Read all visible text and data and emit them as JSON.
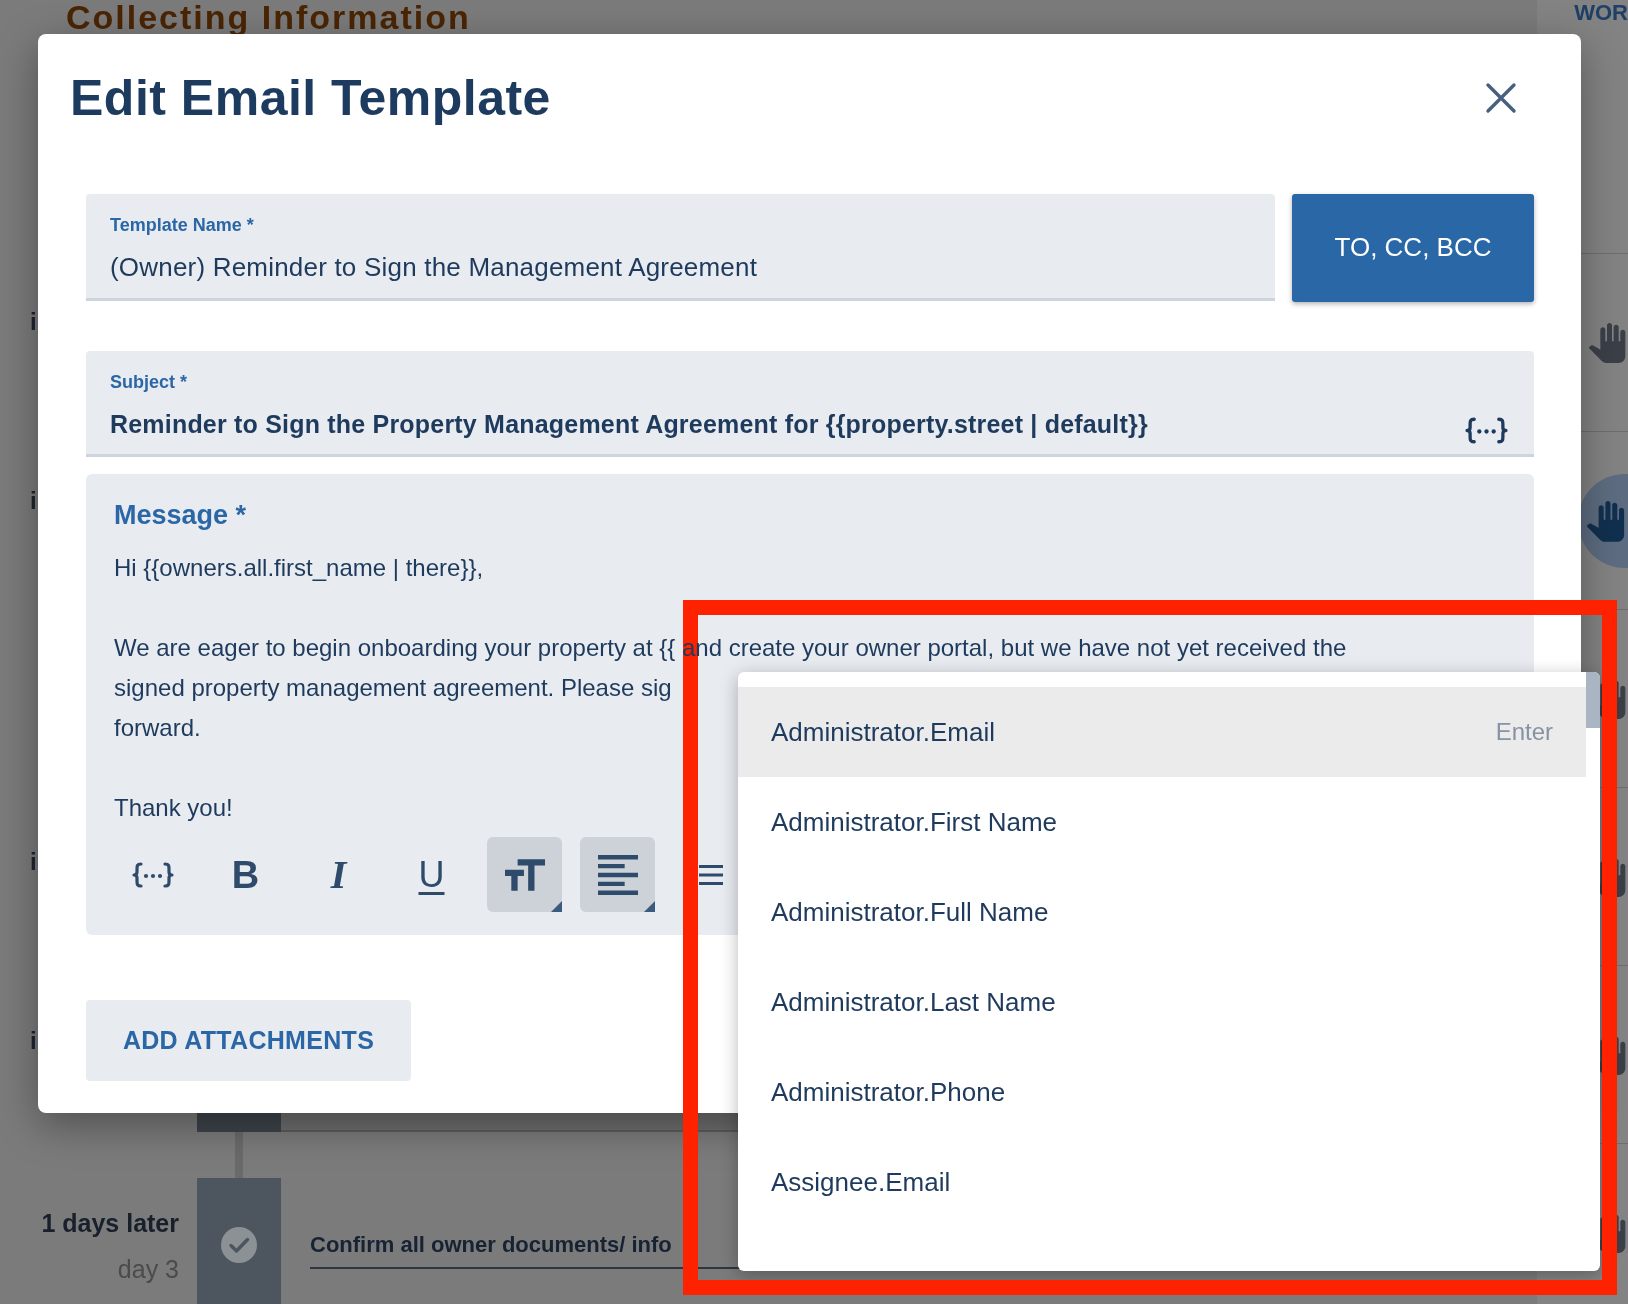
{
  "background_page": {
    "heading": "Collecting Information",
    "top_right_label": "WOR",
    "row_labels": [
      "i",
      "i",
      "i",
      "i"
    ],
    "step": {
      "timing": "1 days later",
      "day": "day 3",
      "title": "Confirm all owner documents/ info",
      "completed": true
    },
    "rail_buttons": [
      {
        "selected": false
      },
      {
        "selected": true
      },
      {
        "selected": false
      },
      {
        "selected": false
      },
      {
        "selected": false
      },
      {
        "selected": false
      }
    ]
  },
  "dialog": {
    "title": "Edit Email Template",
    "template_name": {
      "label": "Template Name *",
      "value": "(Owner) Reminder to Sign the Management Agreement"
    },
    "recipients_button": "TO, CC, BCC",
    "subject": {
      "label": "Subject *",
      "value": "Reminder to Sign the Property Management Agreement for {{property.street | default}}"
    },
    "message": {
      "label": "Message *",
      "paragraphs": [
        [
          "Hi {{owners.all.first_name | there}},"
        ],
        [
          "We are eager to begin onboarding your property at {{ and create your owner portal, but we have not yet received the",
          "signed property management agreement. Please sig",
          "forward."
        ],
        [
          "Thank you!"
        ]
      ],
      "toolbar": [
        {
          "kind": "variable",
          "menu": false
        },
        {
          "kind": "bold",
          "glyph": "B",
          "menu": false
        },
        {
          "kind": "italic",
          "glyph": "I",
          "menu": false
        },
        {
          "kind": "underline",
          "glyph": "U",
          "menu": false
        },
        {
          "kind": "text-size",
          "menu": true
        },
        {
          "kind": "align",
          "menu": true
        },
        {
          "kind": "list",
          "menu": false
        }
      ]
    },
    "add_attachments_button": "ADD ATTACHMENTS"
  },
  "variable_menu": {
    "items": [
      {
        "label": "Administrator.Email",
        "selected": true,
        "hint": "Enter"
      },
      {
        "label": "Administrator.First Name",
        "selected": false
      },
      {
        "label": "Administrator.Full Name",
        "selected": false
      },
      {
        "label": "Administrator.Last Name",
        "selected": false
      },
      {
        "label": "Administrator.Phone",
        "selected": false
      },
      {
        "label": "Assignee.Email",
        "selected": false
      }
    ]
  }
}
